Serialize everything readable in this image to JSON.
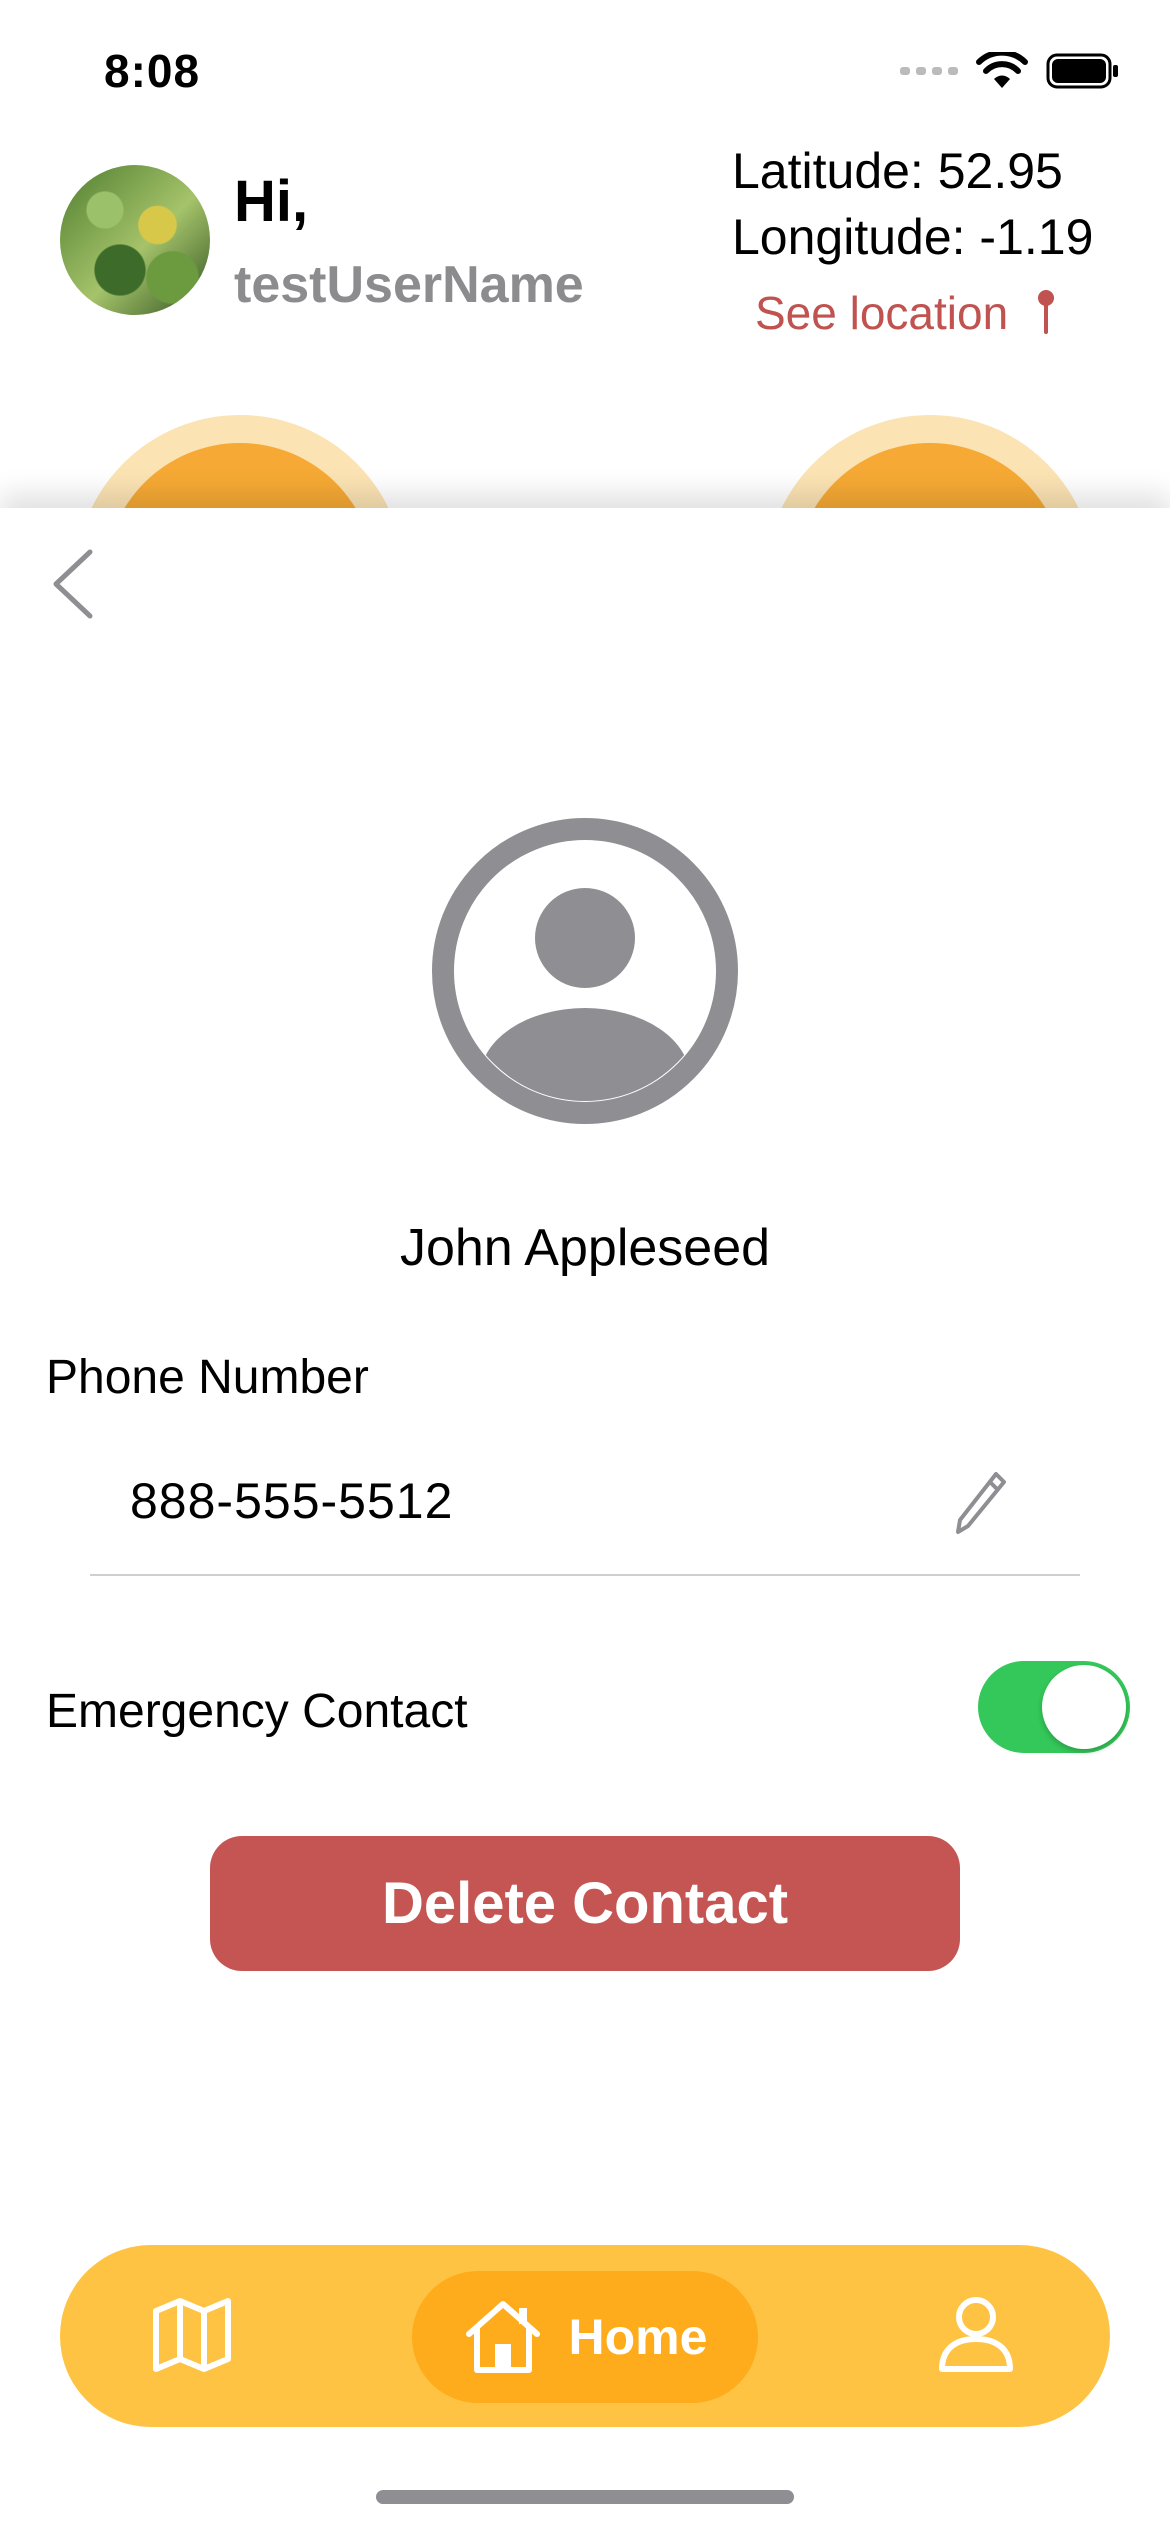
{
  "status_bar": {
    "time": "8:08"
  },
  "header": {
    "greeting": "Hi,",
    "username": "testUserName",
    "latitude": "Latitude: 52.95",
    "longitude": "Longitude:  -1.19",
    "see_location": "See location"
  },
  "contact": {
    "name": "John Appleseed",
    "phone_label": "Phone Number",
    "phone_value": "888-555-5512",
    "emergency_label": "Emergency Contact",
    "emergency_enabled": true,
    "delete_label": "Delete Contact"
  },
  "tabbar": {
    "items": [
      {
        "icon": "map-icon",
        "label": ""
      },
      {
        "icon": "home-icon",
        "label": "Home",
        "active": true
      },
      {
        "icon": "person-icon",
        "label": ""
      }
    ]
  },
  "colors": {
    "accent_red": "#c55553",
    "toggle_green": "#34c759",
    "tabbar_bg": "#fec342",
    "tab_active_bg": "#feab1c",
    "muted_gray": "#8e8e93"
  }
}
